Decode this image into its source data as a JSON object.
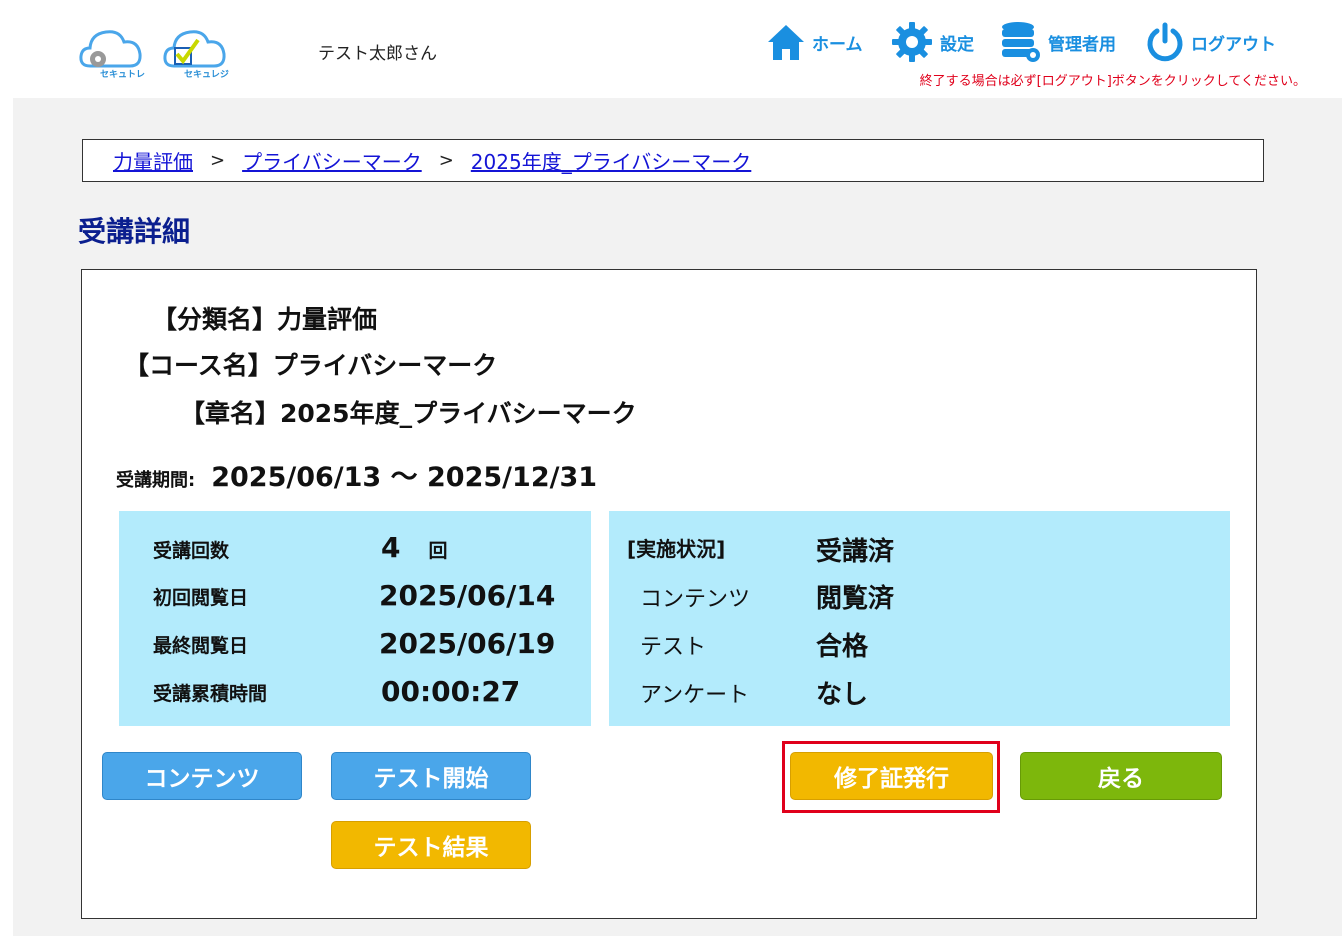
{
  "header": {
    "logos": [
      {
        "caption": "セキュトレ"
      },
      {
        "caption": "セキュレジ"
      }
    ],
    "user_name": "テスト太郎さん",
    "nav": {
      "home": "ホーム",
      "settings": "設定",
      "admin": "管理者用",
      "logout": "ログアウト"
    },
    "logout_note": "終了する場合は必ず[ログアウト]ボタンをクリックしてください。"
  },
  "breadcrumb": {
    "items": [
      "力量評価",
      "プライバシーマーク",
      "2025年度_プライバシーマーク"
    ],
    "separator": ">"
  },
  "page_title": "受講詳細",
  "course": {
    "category": "【分類名】力量評価",
    "course_name": "【コース名】プライバシーマーク",
    "chapter": "【章名】2025年度_プライバシーマーク",
    "period_label": "受講期間:",
    "period_value": "2025/06/13 ～ 2025/12/31"
  },
  "stats": {
    "count_label": "受講回数",
    "count_value": "4",
    "count_unit": "回",
    "first_view_label": "初回閲覧日",
    "first_view_value": "2025/06/14",
    "last_view_label": "最終閲覧日",
    "last_view_value": "2025/06/19",
    "total_time_label": "受講累積時間",
    "total_time_value": "00:00:27"
  },
  "status": {
    "title_label": "[実施状況]",
    "title_value": "受講済",
    "content_label": "コンテンツ",
    "content_value": "閲覧済",
    "test_label": "テスト",
    "test_value": "合格",
    "survey_label": "アンケート",
    "survey_value": "なし"
  },
  "buttons": {
    "contents": "コンテンツ",
    "test_start": "テスト開始",
    "test_result": "テスト結果",
    "certificate": "修了証発行",
    "back": "戻る"
  },
  "colors": {
    "accent_blue": "#1a8fe0",
    "stat_bg": "#b3ebfc",
    "button_blue": "#4aa6ea",
    "button_yellow": "#f2b800",
    "button_green": "#7db70c",
    "highlight_red": "#e0001b",
    "title_navy": "#0b1f8f"
  }
}
